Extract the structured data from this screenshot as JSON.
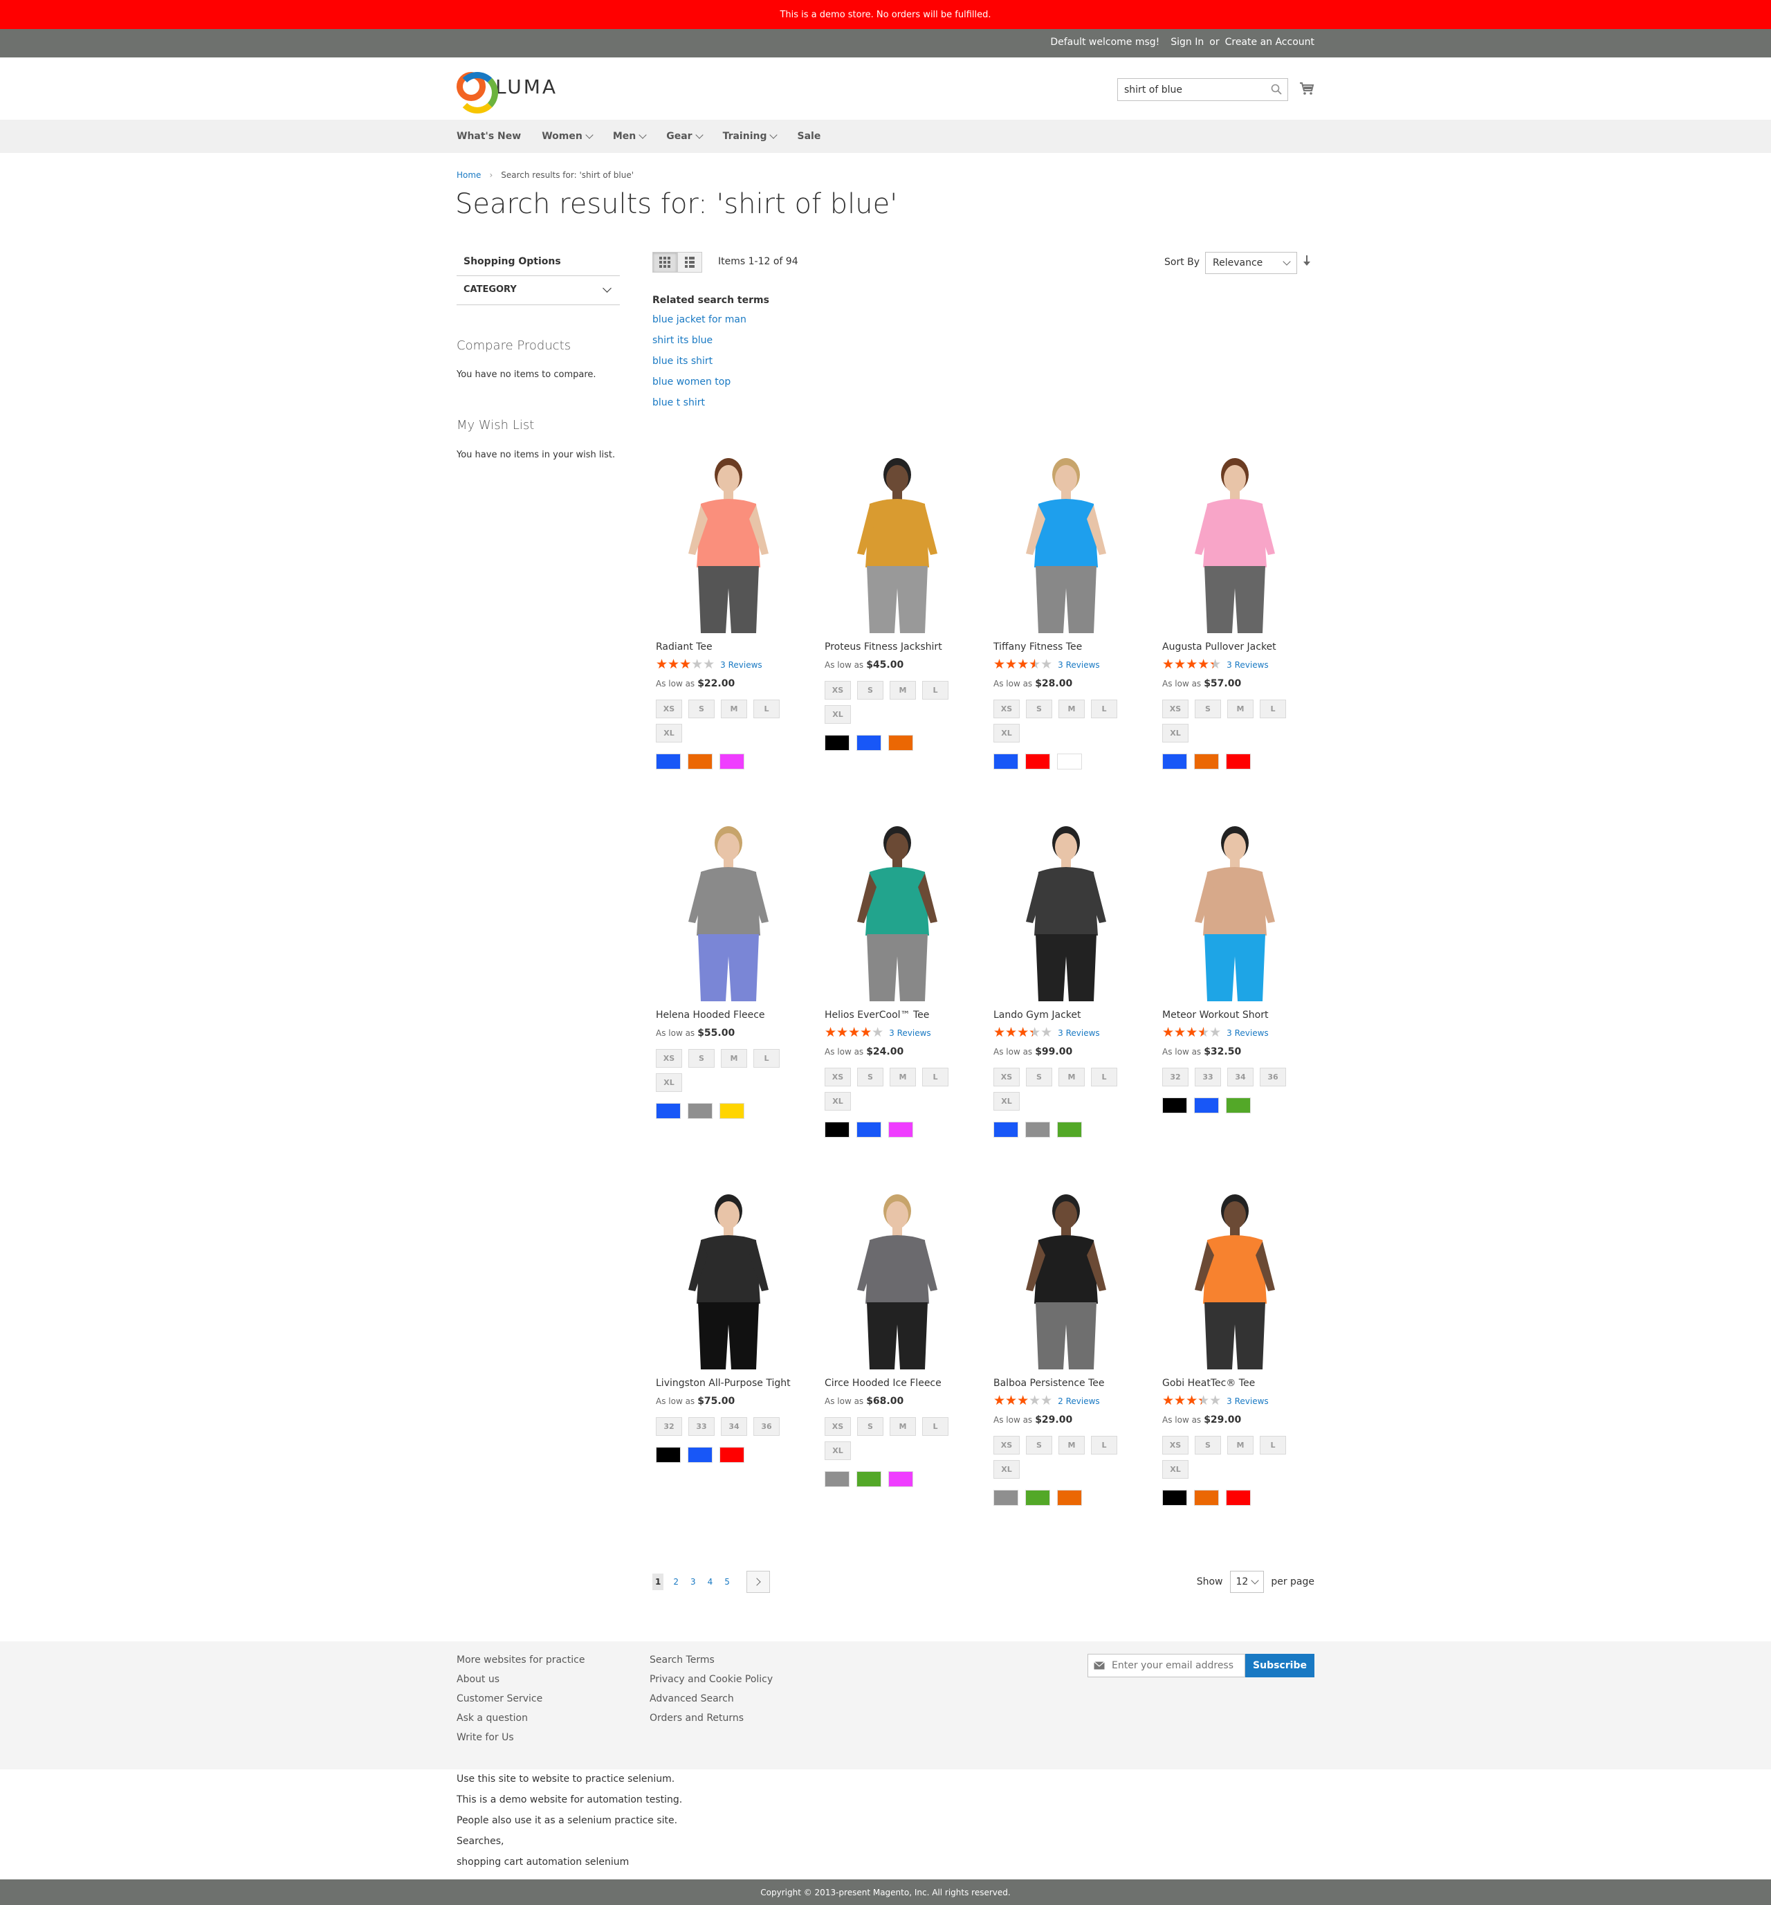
{
  "demo_notice": "This is a demo store. No orders will be fulfilled.",
  "header": {
    "welcome": "Default welcome msg!",
    "sign_in": "Sign In",
    "or": "or",
    "create_account": "Create an Account"
  },
  "logo": {
    "text": "LUMA"
  },
  "search": {
    "value": "shirt of blue"
  },
  "nav": {
    "items": [
      {
        "label": "What's New",
        "dropdown": false
      },
      {
        "label": "Women",
        "dropdown": true
      },
      {
        "label": "Men",
        "dropdown": true
      },
      {
        "label": "Gear",
        "dropdown": true
      },
      {
        "label": "Training",
        "dropdown": true
      },
      {
        "label": "Sale",
        "dropdown": false
      }
    ]
  },
  "breadcrumb": {
    "home": "Home",
    "current": "Search results for: 'shirt of blue'"
  },
  "page_title": "Search results for: 'shirt of blue'",
  "sidebar": {
    "shopping_options": "Shopping Options",
    "category": "CATEGORY",
    "compare_title": "Compare Products",
    "compare_empty": "You have no items to compare.",
    "wishlist_title": "My Wish List",
    "wishlist_empty": "You have no items in your wish list."
  },
  "toolbar": {
    "items_count": "Items 1-12 of 94",
    "sort_label": "Sort By",
    "sort_value": "Relevance"
  },
  "related": {
    "heading": "Related search terms",
    "terms": [
      "blue jacket for man",
      "shirt its blue",
      "blue its shirt",
      "blue women top",
      "blue t shirt"
    ]
  },
  "colors": {
    "demo_bar": "#ff0000",
    "link": "#1979c3",
    "star": "#ff5501",
    "header_gray": "#6e716e"
  },
  "products": [
    {
      "name": "Radiant Tee",
      "rating": 0.6,
      "reviews": "3 Reviews",
      "as_low_as": "As low as",
      "price": "$22.00",
      "sizes": [
        "XS",
        "S",
        "M",
        "L",
        "XL"
      ],
      "swatches": [
        "#1857f7",
        "#eb6703",
        "#ef3dff"
      ]
    },
    {
      "name": "Proteus Fitness Jackshirt",
      "rating": null,
      "reviews": "",
      "as_low_as": "As low as",
      "price": "$45.00",
      "sizes": [
        "XS",
        "S",
        "M",
        "L",
        "XL"
      ],
      "swatches": [
        "#000000",
        "#1857f7",
        "#eb6703"
      ]
    },
    {
      "name": "Tiffany Fitness Tee",
      "rating": 0.7,
      "reviews": "3 Reviews",
      "as_low_as": "As low as",
      "price": "$28.00",
      "sizes": [
        "XS",
        "S",
        "M",
        "L",
        "XL"
      ],
      "swatches": [
        "#1857f7",
        "#ff0000",
        "#ffffff"
      ]
    },
    {
      "name": "Augusta Pullover Jacket",
      "rating": 0.87,
      "reviews": "3 Reviews",
      "as_low_as": "As low as",
      "price": "$57.00",
      "sizes": [
        "XS",
        "S",
        "M",
        "L",
        "XL"
      ],
      "swatches": [
        "#1857f7",
        "#eb6703",
        "#ff0000"
      ]
    },
    {
      "name": "Helena Hooded Fleece",
      "rating": null,
      "reviews": "",
      "as_low_as": "As low as",
      "price": "$55.00",
      "sizes": [
        "XS",
        "S",
        "M",
        "L",
        "XL"
      ],
      "swatches": [
        "#1857f7",
        "#8f8f8f",
        "#ffd500"
      ]
    },
    {
      "name": "Helios EverCool™ Tee",
      "rating": 0.8,
      "reviews": "3 Reviews",
      "as_low_as": "As low as",
      "price": "$24.00",
      "sizes": [
        "XS",
        "S",
        "M",
        "L",
        "XL"
      ],
      "swatches": [
        "#000000",
        "#1857f7",
        "#ef3dff"
      ]
    },
    {
      "name": "Lando Gym Jacket",
      "rating": 0.67,
      "reviews": "3 Reviews",
      "as_low_as": "As low as",
      "price": "$99.00",
      "sizes": [
        "XS",
        "S",
        "M",
        "L",
        "XL"
      ],
      "swatches": [
        "#1857f7",
        "#8f8f8f",
        "#53a828"
      ]
    },
    {
      "name": "Meteor Workout Short",
      "rating": 0.7,
      "reviews": "3 Reviews",
      "as_low_as": "As low as",
      "price": "$32.50",
      "sizes": [
        "32",
        "33",
        "34",
        "36"
      ],
      "swatches": [
        "#000000",
        "#1857f7",
        "#53a828"
      ]
    },
    {
      "name": "Livingston All-Purpose Tight",
      "rating": null,
      "reviews": "",
      "as_low_as": "As low as",
      "price": "$75.00",
      "sizes": [
        "32",
        "33",
        "34",
        "36"
      ],
      "swatches": [
        "#000000",
        "#1857f7",
        "#ff0000"
      ]
    },
    {
      "name": "Circe Hooded Ice Fleece",
      "rating": null,
      "reviews": "",
      "as_low_as": "As low as",
      "price": "$68.00",
      "sizes": [
        "XS",
        "S",
        "M",
        "L",
        "XL"
      ],
      "swatches": [
        "#8f8f8f",
        "#53a828",
        "#ef3dff"
      ]
    },
    {
      "name": "Balboa Persistence Tee",
      "rating": 0.6,
      "reviews": "2 Reviews",
      "as_low_as": "As low as",
      "price": "$29.00",
      "sizes": [
        "XS",
        "S",
        "M",
        "L",
        "XL"
      ],
      "swatches": [
        "#8f8f8f",
        "#53a828",
        "#eb6703"
      ]
    },
    {
      "name": "Gobi HeatTec® Tee",
      "rating": 0.67,
      "reviews": "3 Reviews",
      "as_low_as": "As low as",
      "price": "$29.00",
      "sizes": [
        "XS",
        "S",
        "M",
        "L",
        "XL"
      ],
      "swatches": [
        "#000000",
        "#eb6703",
        "#ff0000"
      ]
    }
  ],
  "pager": {
    "current": "1",
    "pages": [
      "2",
      "3",
      "4",
      "5"
    ],
    "show_label": "Show",
    "per_page_value": "12",
    "per_page_label": "per page"
  },
  "footer": {
    "col1": [
      "More websites for practice",
      "About us",
      "Customer Service",
      "Ask a question",
      "Write for Us"
    ],
    "col2": [
      "Search Terms",
      "Privacy and Cookie Policy",
      "Advanced Search",
      "Orders and Returns"
    ],
    "newsletter_placeholder": "Enter your email address",
    "subscribe": "Subscribe"
  },
  "seo_lines": [
    "Use this site to website to practice selenium.",
    "This is a demo website for automation testing.",
    "People also use it as a selenium practice site.",
    "Searches,",
    "shopping cart automation selenium"
  ],
  "copyright": "Copyright © 2013-present Magento, Inc. All rights reserved."
}
